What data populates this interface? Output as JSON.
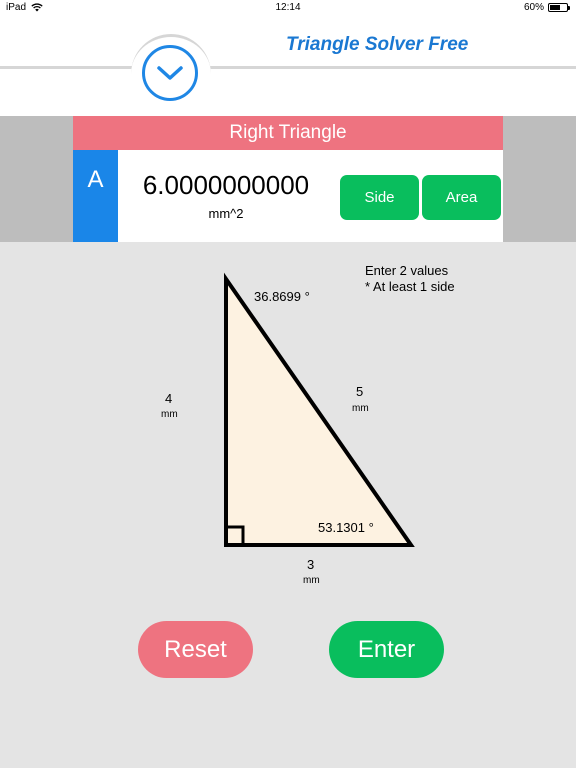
{
  "status_bar": {
    "device": "iPad",
    "time": "12:14",
    "battery_percent": "60%",
    "battery_level": 0.6
  },
  "header": {
    "title": "Triangle Solver Free",
    "collapse_icon": "chevron-down-icon"
  },
  "panel": {
    "title": "Right Triangle",
    "field_label": "A",
    "value": "6.0000000000",
    "unit": "mm^2",
    "side_button": "Side",
    "area_button": "Area"
  },
  "triangle": {
    "instruction_line1": "Enter 2 values",
    "instruction_line2": "* At least 1 side",
    "angle_top": "36.8699 °",
    "angle_bottom": "53.1301 °",
    "side_left": {
      "value": "4",
      "unit": "mm"
    },
    "side_hyp": {
      "value": "5",
      "unit": "mm"
    },
    "side_bottom": {
      "value": "3",
      "unit": "mm"
    }
  },
  "buttons": {
    "reset": "Reset",
    "enter": "Enter"
  },
  "colors": {
    "accent_blue": "#1a86e8",
    "title_blue": "#1a78d2",
    "panel_pink": "#ee7380",
    "button_green": "#09be5d",
    "triangle_fill": "#fdf2e1"
  }
}
